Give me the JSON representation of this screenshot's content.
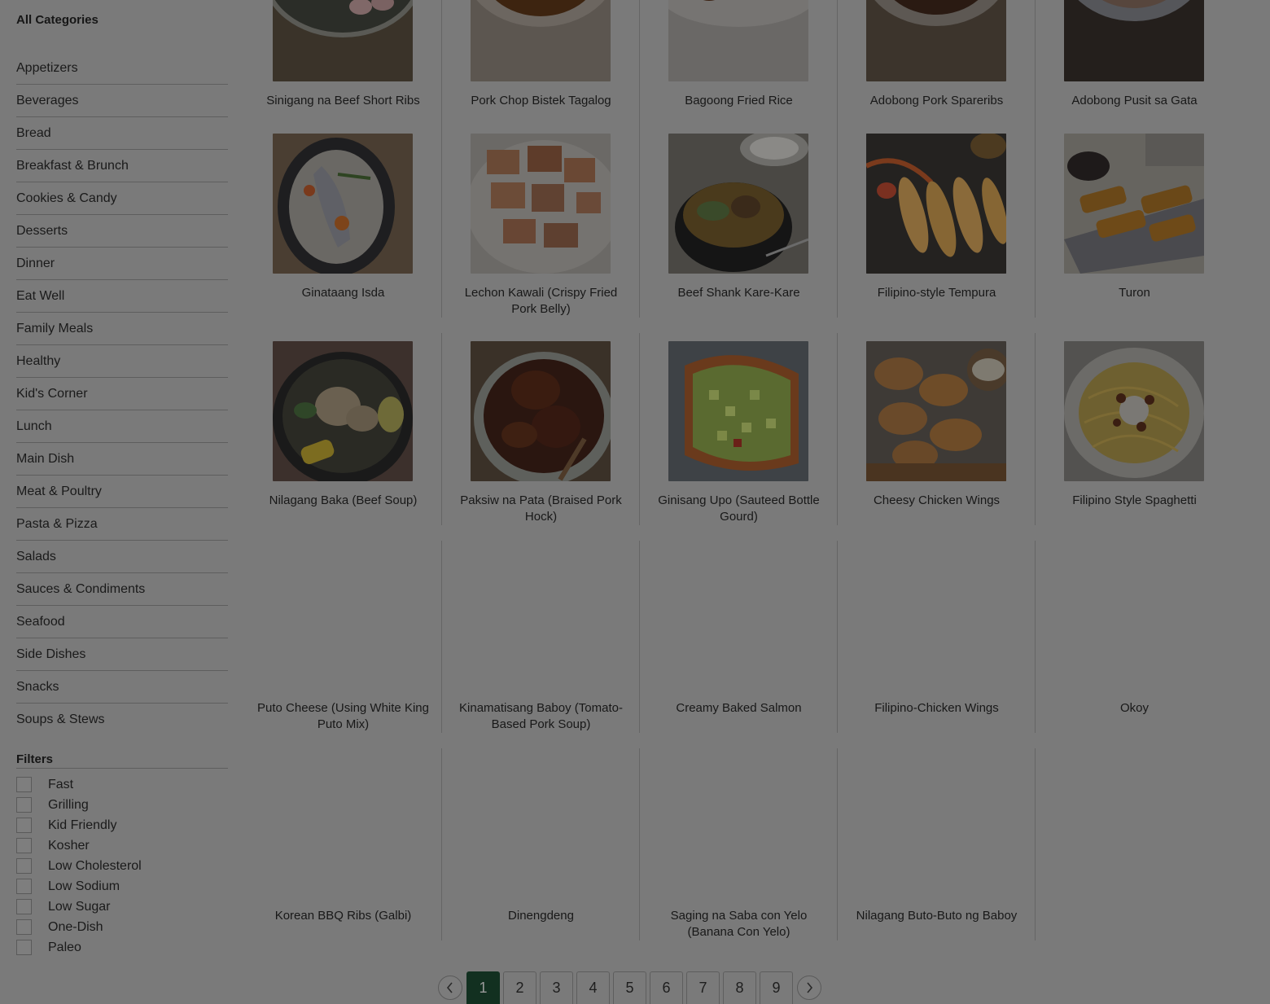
{
  "sidebar": {
    "categories_heading": "All Categories",
    "categories": [
      "Appetizers",
      "Beverages",
      "Bread",
      "Breakfast & Brunch",
      "Cookies & Candy",
      "Desserts",
      "Dinner",
      "Eat Well",
      "Family Meals",
      "Healthy",
      "Kid's Corner",
      "Lunch",
      "Main Dish",
      "Meat & Poultry",
      "Pasta & Pizza",
      "Salads",
      "Sauces & Condiments",
      "Seafood",
      "Side Dishes",
      "Snacks",
      "Soups & Stews"
    ],
    "filters_heading": "Filters",
    "filters": [
      "Fast",
      "Grilling",
      "Kid Friendly",
      "Kosher",
      "Low Cholesterol",
      "Low Sodium",
      "Low Sugar",
      "One-Dish",
      "Paleo"
    ]
  },
  "recipes": [
    {
      "title": "Sinigang na Beef Short Ribs",
      "image": "sinigang-photo"
    },
    {
      "title": "Pork Chop Bistek Tagalog",
      "image": "bistek-photo"
    },
    {
      "title": "Bagoong Fried Rice",
      "image": "fried-rice-photo"
    },
    {
      "title": "Adobong Pork Spareribs",
      "image": "adobo-ribs-photo"
    },
    {
      "title": "Adobong Pusit sa Gata",
      "image": "adobong-pusit-photo"
    },
    {
      "title": "Ginataang Isda",
      "image": "ginataang-isda-photo"
    },
    {
      "title": "Lechon Kawali (Crispy Fried Pork Belly)",
      "image": "lechon-kawali-photo"
    },
    {
      "title": "Beef Shank Kare-Kare",
      "image": "kare-kare-photo"
    },
    {
      "title": "Filipino-style Tempura",
      "image": "tempura-photo"
    },
    {
      "title": "Turon",
      "image": "turon-photo"
    },
    {
      "title": "Nilagang Baka (Beef Soup)",
      "image": "nilaga-photo"
    },
    {
      "title": "Paksiw na Pata (Braised Pork Hock)",
      "image": "paksiw-photo"
    },
    {
      "title": "Ginisang Upo (Sauteed Bottle Gourd)",
      "image": "upo-photo"
    },
    {
      "title": "Cheesy Chicken Wings",
      "image": "wings-photo"
    },
    {
      "title": "Filipino Style Spaghetti",
      "image": "spaghetti-photo"
    },
    {
      "title": "Puto Cheese (Using White King Puto Mix)",
      "image": ""
    },
    {
      "title": "Kinamatisang Baboy (Tomato-Based Pork Soup)",
      "image": ""
    },
    {
      "title": "Creamy Baked Salmon",
      "image": ""
    },
    {
      "title": "Filipino-Chicken Wings",
      "image": ""
    },
    {
      "title": "Okoy",
      "image": ""
    },
    {
      "title": "Korean BBQ Ribs (Galbi)",
      "image": ""
    },
    {
      "title": "Dinengdeng",
      "image": ""
    },
    {
      "title": "Saging na Saba con Yelo (Banana Con Yelo)",
      "image": ""
    },
    {
      "title": "Nilagang Buto-Buto ng Baboy",
      "image": ""
    }
  ],
  "pagination": {
    "prev_icon": "chevron-left-icon",
    "next_icon": "chevron-right-icon",
    "pages": [
      "1",
      "2",
      "3",
      "4",
      "5",
      "6",
      "7",
      "8",
      "9"
    ],
    "current": "1"
  },
  "colors": {
    "overlay_background": "#7a7a7a",
    "active_page": "#123020"
  }
}
